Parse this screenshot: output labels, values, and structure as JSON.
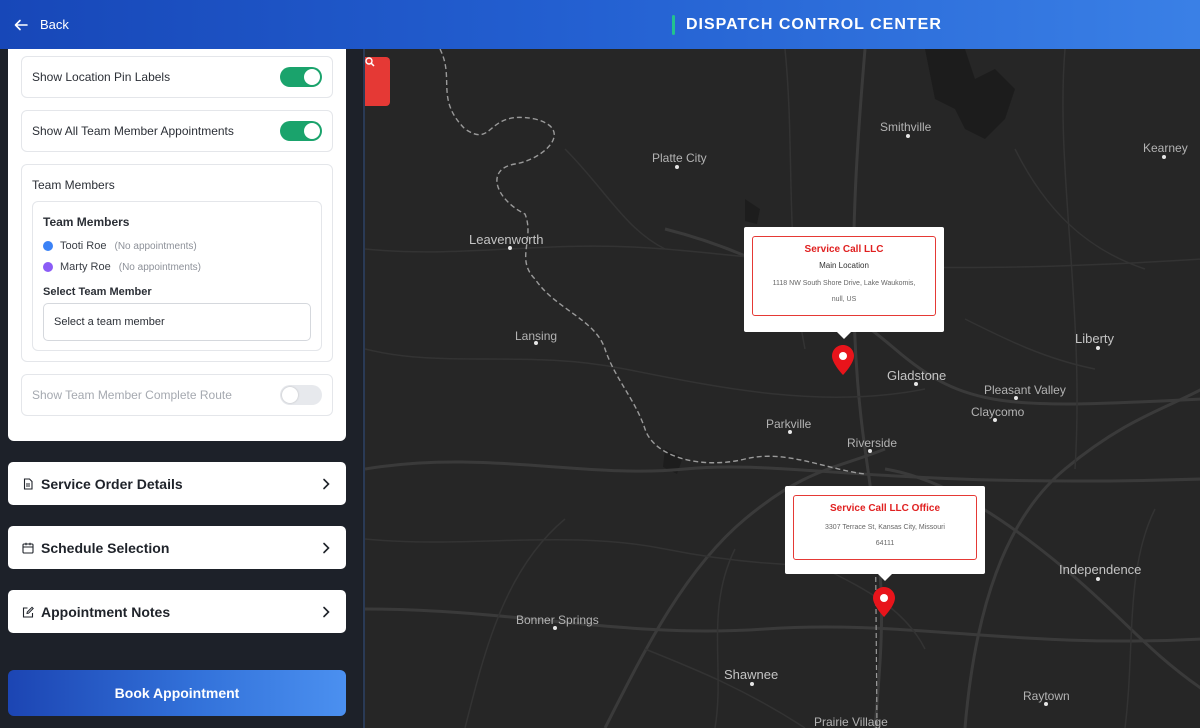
{
  "header": {
    "back_label": "Back",
    "title": "DISPATCH CONTROL CENTER"
  },
  "sidebar": {
    "toggles": {
      "pin_labels": {
        "label": "Show Location Pin Labels",
        "on": true
      },
      "all_appointments": {
        "label": "Show All Team Member Appointments",
        "on": true
      },
      "complete_route": {
        "label": "Show Team Member Complete Route",
        "on": false
      }
    },
    "team": {
      "box_title": "Team Members",
      "inner_title": "Team Members",
      "members": [
        {
          "name": "Tooti Roe",
          "note": "(No appointments)",
          "color": "#3b82f6"
        },
        {
          "name": "Marty Roe",
          "note": "(No appointments)",
          "color": "#8b5cf6"
        }
      ],
      "select_label": "Select Team Member",
      "select_value": "Select a team member"
    },
    "accordions": [
      {
        "label": "Service Order Details",
        "icon": "document-icon"
      },
      {
        "label": "Schedule Selection",
        "icon": "calendar-icon"
      },
      {
        "label": "Appointment Notes",
        "icon": "edit-icon"
      }
    ],
    "book_label": "Book Appointment"
  },
  "map": {
    "cities": {
      "smithville": "Smithville",
      "kearney": "Kearney",
      "platte_city": "Platte City",
      "leavenworth": "Leavenworth",
      "lansing": "Lansing",
      "liberty": "Liberty",
      "gladstone": "Gladstone",
      "pleasant_valley": "Pleasant Valley",
      "claycomo": "Claycomo",
      "parkville": "Parkville",
      "riverside": "Riverside",
      "independence": "Independence",
      "bonner_springs": "Bonner Springs",
      "shawnee": "Shawnee",
      "raytown": "Raytown",
      "prairie_village": "Prairie Village"
    },
    "popups": {
      "main": {
        "title": "Service Call LLC",
        "subtitle": "Main Location",
        "address_line1": "1118 NW  South Shore Drive, Lake Waukomis,",
        "address_line2": "null, US"
      },
      "office": {
        "title": "Service Call LLC Office",
        "address_line1": "3307 Terrace St, Kansas City, Missouri",
        "address_line2": "64111"
      }
    }
  }
}
